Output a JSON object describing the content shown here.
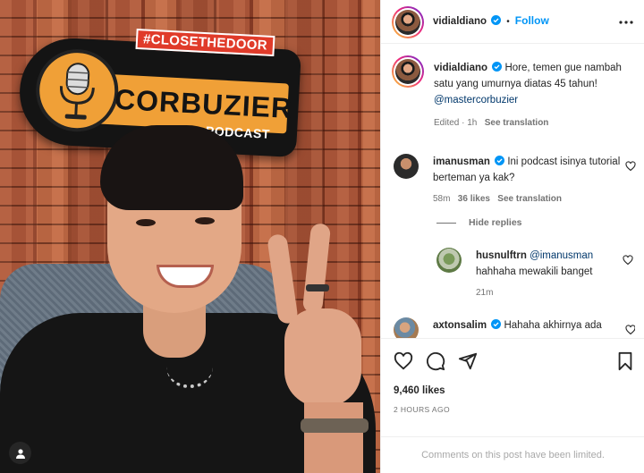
{
  "photo": {
    "sign_tag": "#CLOSETHEDOOR",
    "sign_main": "CORBUZIER",
    "sign_sub": "PODCAST"
  },
  "header": {
    "username": "vidialdiano",
    "follow_label": "Follow",
    "separator": "•"
  },
  "caption": {
    "username": "vidialdiano",
    "text": "Hore, temen gue nambah satu yang umurnya diatas 45 tahun!",
    "mention": "@mastercorbuzier",
    "meta_time": "Edited · 1h",
    "translation": "See translation"
  },
  "comments": [
    {
      "username": "imanusman",
      "text": "Ini podcast isinya tutorial berteman ya kak?",
      "time": "58m",
      "likes": "36 likes",
      "translation": "See translation"
    },
    {
      "username": "husnulftrn",
      "mention": "@imanusman",
      "text": "hahhaha mewakili banget",
      "time": "21m"
    },
    {
      "username": "axtonsalim",
      "text": "Hahaha akhirnya ada"
    }
  ],
  "hide_replies": "Hide replies",
  "stats": {
    "likes": "9,460 likes",
    "time": "2 HOURS AGO"
  },
  "footer": {
    "limited": "Comments on this post have been limited."
  },
  "colors": {
    "accent": "#0095f6",
    "verified": "#0095f6",
    "mention": "#00376b",
    "muted": "#737373"
  },
  "icons": [
    "more-icon",
    "verified-icon",
    "heart-icon",
    "comment-icon",
    "share-icon",
    "bookmark-icon",
    "user-tag-icon"
  ]
}
